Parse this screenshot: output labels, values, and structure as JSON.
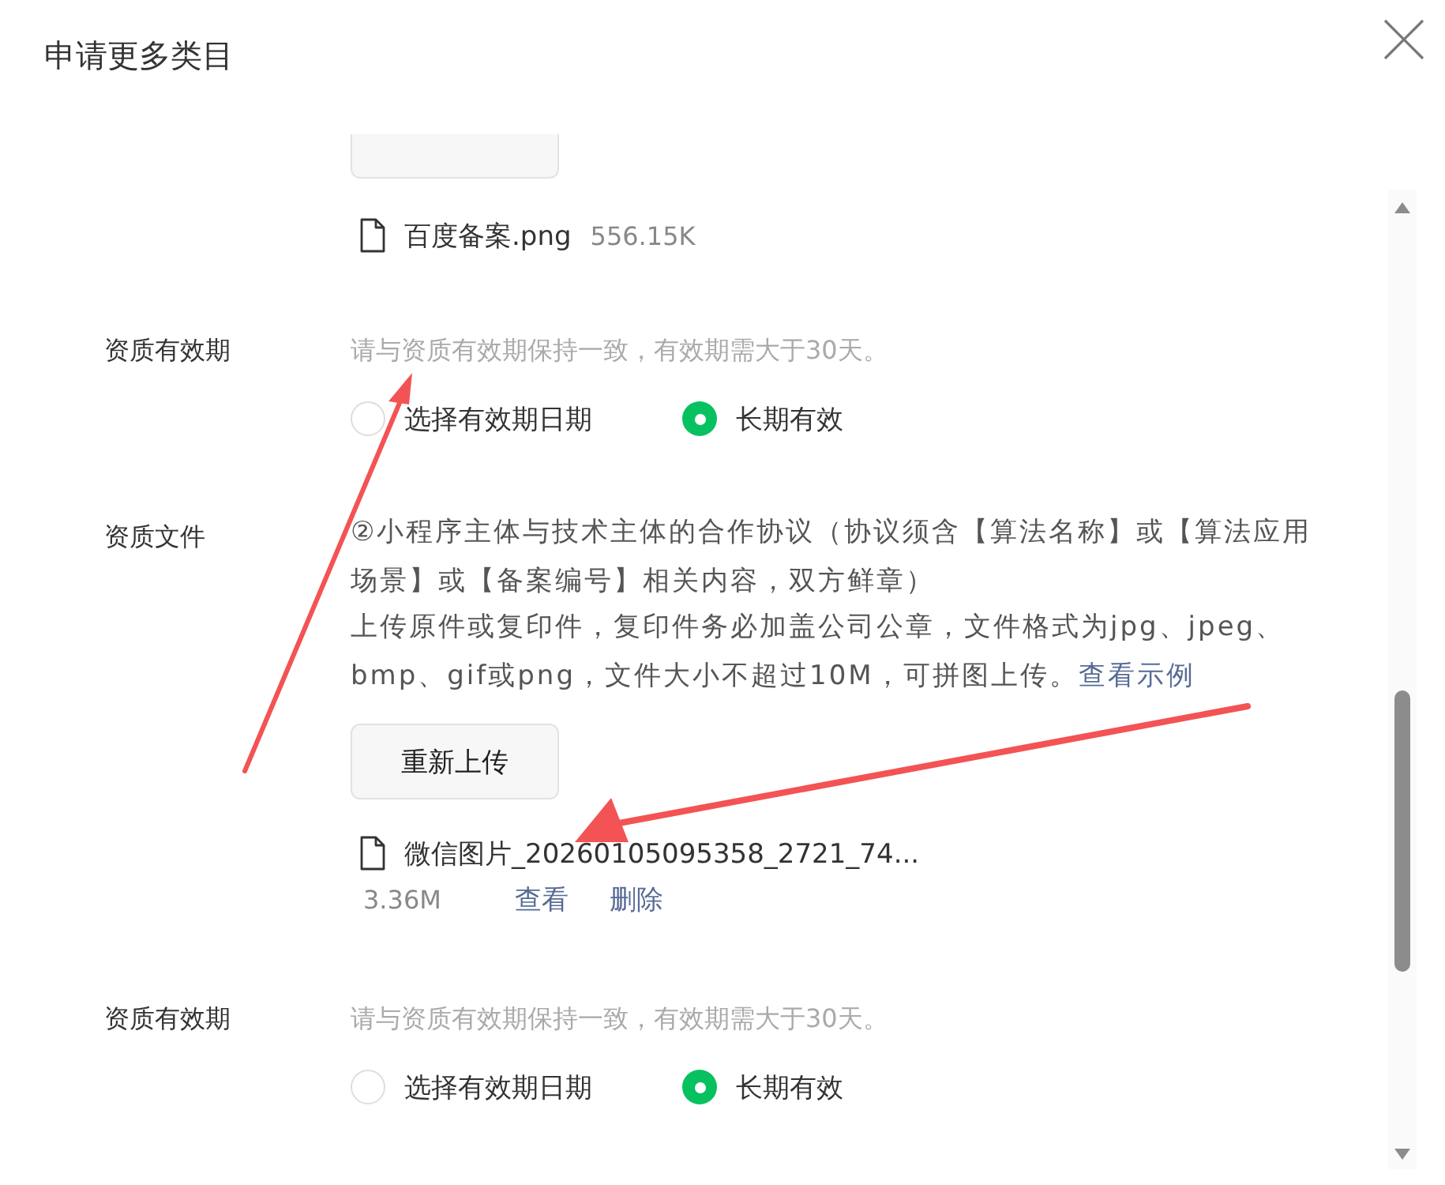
{
  "dialog": {
    "title": "申请更多类目"
  },
  "top_file": {
    "name": "百度备案.png",
    "size": "556.15K"
  },
  "sections": [
    {
      "kind": "validity",
      "label": "资质有效期",
      "hint": "请与资质有效期保持一致，有效期需大于30天。",
      "options": [
        {
          "label": "选择有效期日期",
          "selected": false
        },
        {
          "label": "长期有效",
          "selected": true
        }
      ]
    },
    {
      "kind": "file",
      "label": "资质文件",
      "description": "②小程序主体与技术主体的合作协议（协议须含【算法名称】或【算法应用场景】或【备案编号】相关内容，双方鲜章）",
      "note": "上传原件或复印件，复印件务必加盖公司公章，文件格式为jpg、jpeg、bmp、gif或png，文件大小不超过10M，可拼图上传。",
      "link": "查看示例",
      "button": "重新上传",
      "file": {
        "name": "微信图片_20260105095358_2721_74...",
        "size": "3.36M",
        "actions": [
          "查看",
          "删除"
        ]
      }
    },
    {
      "kind": "validity",
      "label": "资质有效期",
      "hint": "请与资质有效期保持一致，有效期需大于30天。",
      "options": [
        {
          "label": "选择有效期日期",
          "selected": false
        },
        {
          "label": "长期有效",
          "selected": true
        }
      ]
    }
  ]
}
